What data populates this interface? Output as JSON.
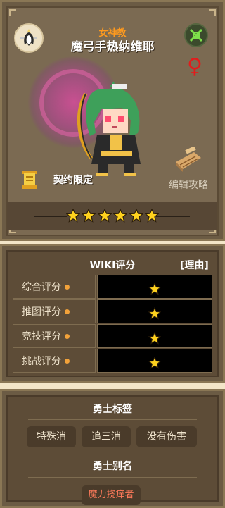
{
  "hero": {
    "faction": "女神教",
    "name": "魔弓手热纳维耶",
    "gender_symbol": "♀",
    "contract_label": "契约限定",
    "guide_label": "编辑攻略",
    "stars": 6,
    "colors": {
      "faction": "#ff9a1e",
      "gender": "#e21c1c",
      "star": "#ffd21e"
    }
  },
  "wiki": {
    "title": "WIKI评分",
    "reason_link": "[理由]",
    "ratings": [
      {
        "label": "综合评分",
        "stars": 1
      },
      {
        "label": "推图评分",
        "stars": 1
      },
      {
        "label": "竞技评分",
        "stars": 1
      },
      {
        "label": "挑战评分",
        "stars": 1
      }
    ]
  },
  "tags": {
    "title": "勇士标签",
    "items": [
      "特殊消",
      "追三消",
      "没有伤害"
    ]
  },
  "aliases": {
    "title": "勇士别名",
    "items": [
      "魔力挠痒者"
    ]
  }
}
